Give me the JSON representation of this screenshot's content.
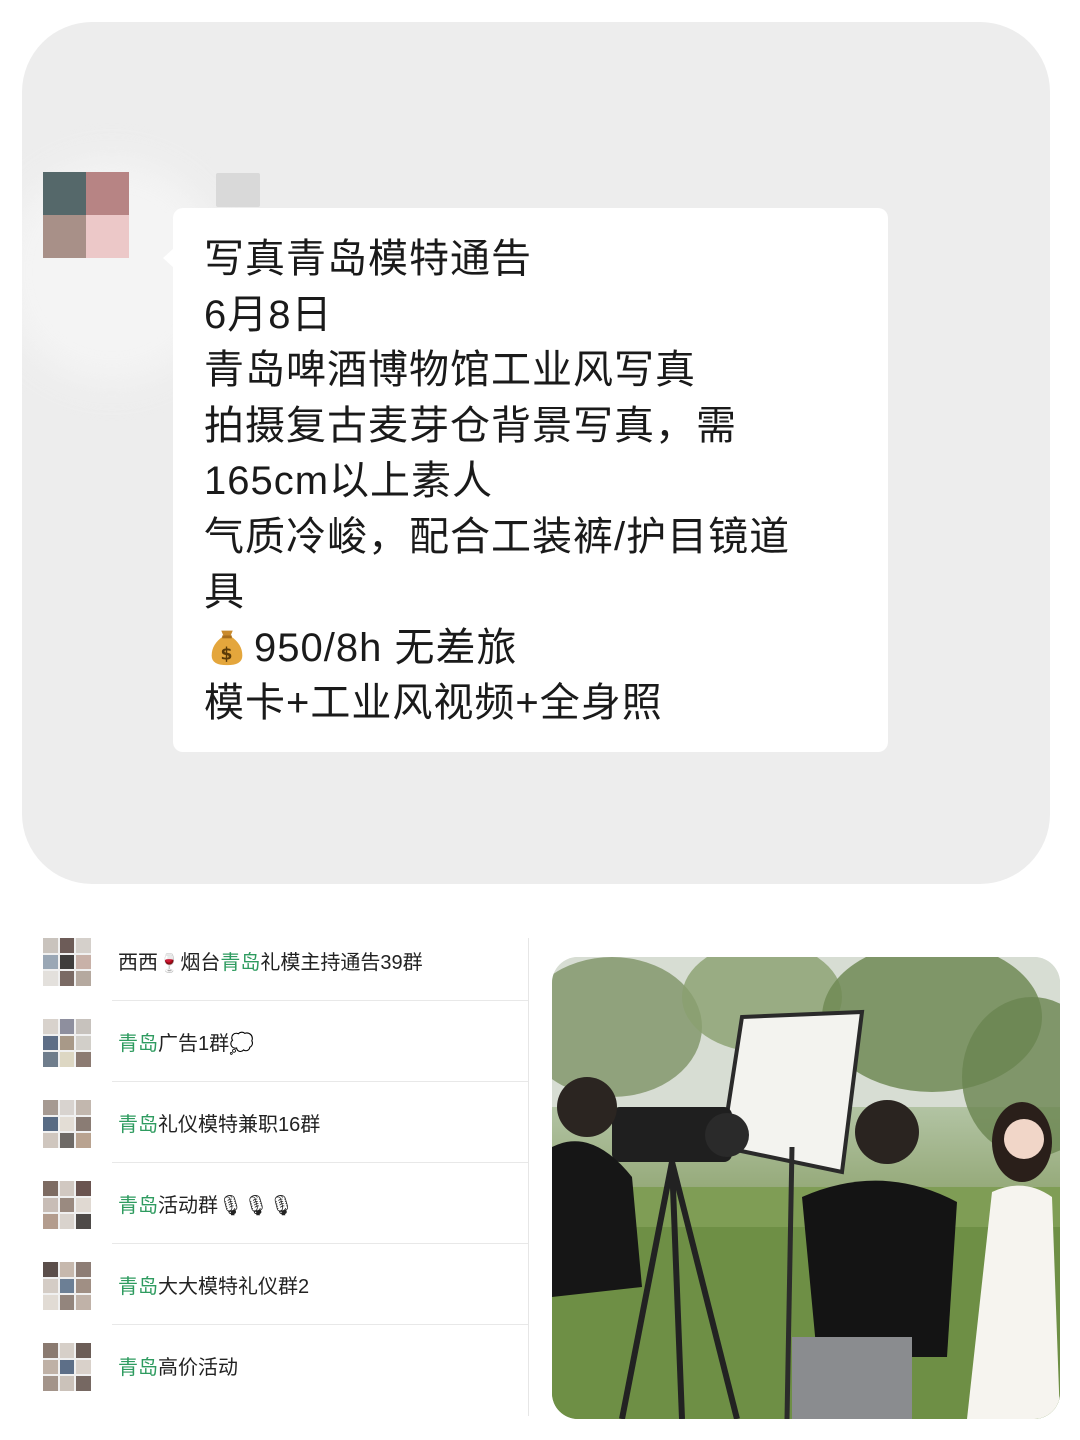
{
  "message": {
    "lines": [
      "写真青岛模特通告",
      "6月8日",
      "青岛啤酒博物馆工业风写真",
      "拍摄复古麦芽仓背景写真，需",
      "165cm以上素人",
      "气质冷峻，配合工装裤/护目镜道",
      "具",
      "950/8h 无差旅",
      "模卡+工业风视频+全身照"
    ],
    "money_icon": "money-bag-icon"
  },
  "groups": [
    {
      "prefix": "西西",
      "emoji": "🍷",
      "mid": "烟台",
      "highlight": "青岛",
      "suffix": "礼模主持通告39群"
    },
    {
      "prefix": "",
      "emoji": "",
      "mid": "",
      "highlight": "青岛",
      "suffix": "广告1群💭"
    },
    {
      "prefix": "",
      "emoji": "",
      "mid": "",
      "highlight": "青岛",
      "suffix": "礼仪模特兼职16群"
    },
    {
      "prefix": "",
      "emoji": "",
      "mid": "",
      "highlight": "青岛",
      "suffix": "活动群🎙🎙🎙"
    },
    {
      "prefix": "",
      "emoji": "",
      "mid": "",
      "highlight": "青岛",
      "suffix": "大大模特礼仪群2"
    },
    {
      "prefix": "",
      "emoji": "",
      "mid": "",
      "highlight": "青岛",
      "suffix": "高价活动"
    }
  ],
  "colors": {
    "highlight": "#2e9b5f",
    "panel_bg": "#ededed",
    "bubble_bg": "#ffffff"
  }
}
